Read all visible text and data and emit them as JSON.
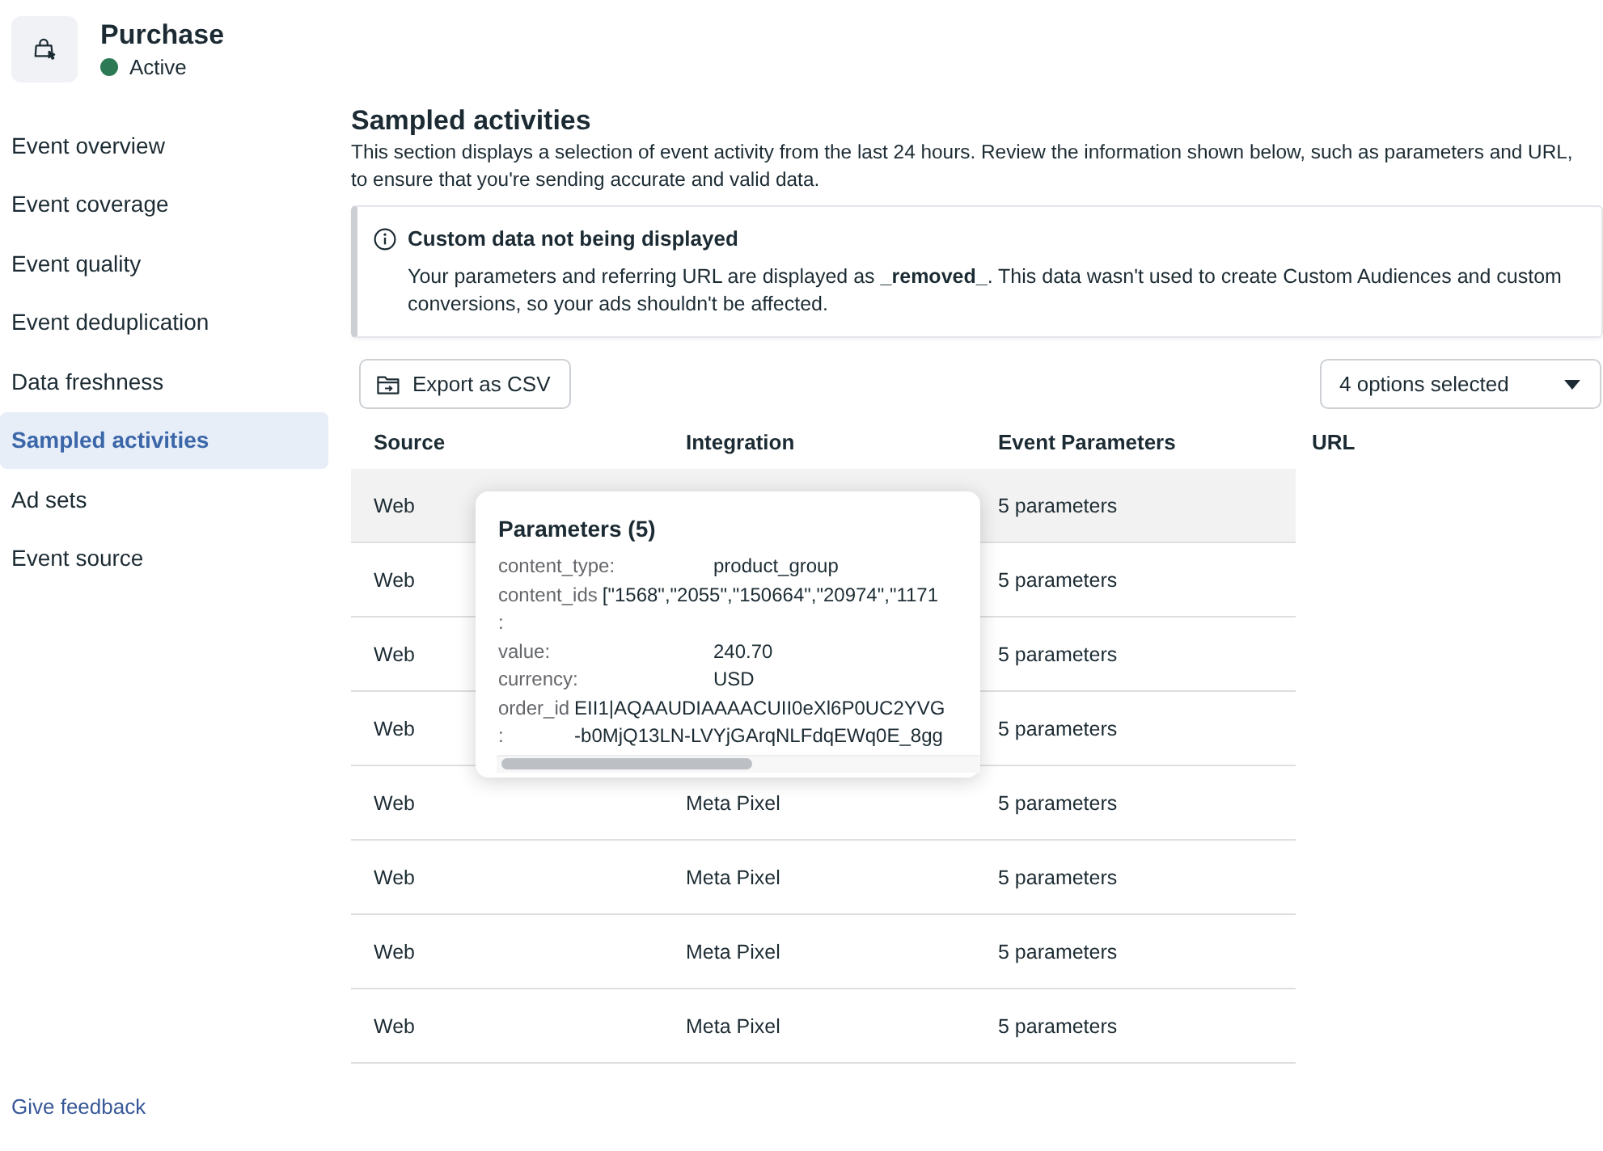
{
  "header": {
    "title": "Purchase",
    "status": "Active"
  },
  "sidebar": {
    "items": [
      {
        "label": "Event overview",
        "selected": false
      },
      {
        "label": "Event coverage",
        "selected": false
      },
      {
        "label": "Event quality",
        "selected": false
      },
      {
        "label": "Event deduplication",
        "selected": false
      },
      {
        "label": "Data freshness",
        "selected": false
      },
      {
        "label": "Sampled activities",
        "selected": true
      },
      {
        "label": "Ad sets",
        "selected": false
      },
      {
        "label": "Event source",
        "selected": false
      }
    ],
    "footer_link": "Give feedback"
  },
  "main": {
    "title": "Sampled activities",
    "description": "This section displays a selection of event activity from the last 24 hours. Review the information shown below, such as parameters and URL, to ensure that you're sending accurate and valid data.",
    "notice": {
      "title": "Custom data not being displayed",
      "body": "Your parameters and referring URL are displayed as **_removed_**. This data wasn't used to create Custom Audiences and custom conversions, so your ads shouldn't be affected."
    }
  },
  "toolbar": {
    "export_button": "Export as CSV",
    "filter": {
      "value": "4 options selected"
    }
  },
  "table": {
    "columns": [
      "Source",
      "Integration",
      "Event Parameters",
      "URL"
    ],
    "rows": [
      {
        "source": "Web",
        "event_parameters": "5 parameters",
        "hovered": true
      },
      {
        "source": "Web",
        "event_parameters": "5 parameters",
        "hovered": false
      },
      {
        "source": "Web",
        "event_parameters": "5 parameters",
        "hovered": false
      },
      {
        "source": "Web",
        "event_parameters": "5 parameters",
        "hovered": false
      },
      {
        "source": "Web",
        "integration": "Meta Pixel",
        "event_parameters": "5 parameters",
        "hovered": false
      },
      {
        "source": "Web",
        "integration": "Meta Pixel",
        "event_parameters": "5 parameters",
        "hovered": false
      },
      {
        "source": "Web",
        "integration": "Meta Pixel",
        "event_parameters": "5 parameters",
        "hovered": false
      },
      {
        "source": "Web",
        "integration": "Meta Pixel",
        "event_parameters": "5 parameters",
        "hovered": false
      }
    ]
  },
  "tooltip": {
    "title": "Parameters (5)",
    "params": [
      {
        "key": [
          "content_type:"
        ],
        "value": [
          "product_group"
        ]
      },
      {
        "key": [
          "content_ids",
          ":"
        ],
        "value": [
          "[\"1568\",\"2055\",\"150664\",\"20974\",\"1171"
        ]
      },
      {
        "key": [
          "value:"
        ],
        "value": [
          "240.70"
        ]
      },
      {
        "key": [
          "currency:"
        ],
        "value": [
          "USD"
        ]
      },
      {
        "key": [
          "order_id",
          ":"
        ],
        "value": [
          "EII1|AQAAUDIAAAACUII0eXl6P0UC2YVG",
          "-b0MjQ13LN-LVYjGArqNLFdqEWq0E_8gg"
        ]
      }
    ]
  }
}
